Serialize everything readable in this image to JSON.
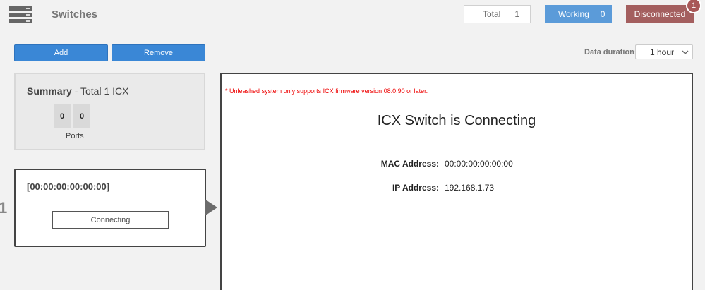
{
  "header": {
    "title": "Switches",
    "icon": "server-rack-icon",
    "stats": {
      "total_label": "Total",
      "total_value": "1",
      "working_label": "Working",
      "working_value": "0",
      "disconnected_label": "Disconnected",
      "disconnected_badge": "1"
    },
    "colors": {
      "working": "#5b9bd9",
      "disconnected": "#a45f5f",
      "primary": "#3a87d6"
    }
  },
  "toolbar": {
    "add_label": "Add",
    "remove_label": "Remove",
    "duration_label": "Data duration:",
    "duration_value": "1 hour"
  },
  "summary": {
    "title": "Summary",
    "total_text": "- Total 1 ICX",
    "port_values": [
      "0",
      "0"
    ],
    "ports_label": "Ports"
  },
  "switches": [
    {
      "index": "1",
      "mac": "[00:00:00:00:00:00]",
      "status": "Connecting"
    }
  ],
  "detail": {
    "warning_mark": "*",
    "warning": "Unleashed system only supports ICX firmware version 08.0.90 or later.",
    "title": "ICX Switch is Connecting",
    "mac_label": "MAC Address:",
    "mac_value": "00:00:00:00:00:00",
    "ip_label": "IP Address:",
    "ip_value": "192.168.1.73"
  }
}
